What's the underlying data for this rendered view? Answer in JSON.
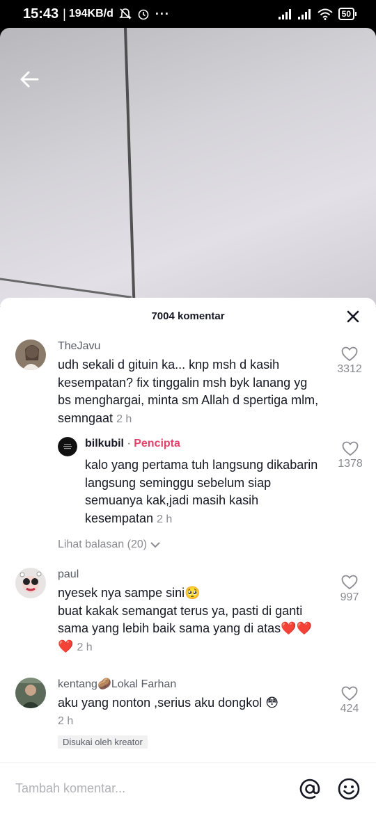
{
  "status_bar": {
    "time": "15:43",
    "separator": "|",
    "speed": "194KB/d",
    "more": "···",
    "battery": "50"
  },
  "sheet": {
    "title": "7004 komentar",
    "input_placeholder": "Tambah komentar..."
  },
  "comments": [
    {
      "user": "TheJavu",
      "text": "udh sekali d gituin ka... knp msh d kasih kesempatan? fix tinggalin msh byk lanang yg bs menghargai, minta sm Allah d spertiga mlm, semngaat",
      "time": "2 h",
      "likes": "3312",
      "reply": {
        "user": "bilkubil",
        "dot": " · ",
        "badge": "Pencipta",
        "text": "kalo yang pertama tuh langsung dikabarin langsung seminggu sebelum siap semuanya kak,jadi masih kasih kesempatan",
        "time": "2 h",
        "likes": "1378"
      },
      "view_replies": "Lihat balasan (20)"
    },
    {
      "user": "paul",
      "text_line1": "nyesek nya sampe sini🥺",
      "text_line2": "buat kakak semangat terus ya, pasti di ganti sama yang lebih baik sama yang di atas❤️❤️❤️",
      "time": "2 h",
      "likes": "997"
    },
    {
      "user": "kentang🥔Lokal Farhan",
      "text": "aku yang nonton ,serius aku dongkol 😳",
      "time": "2 h",
      "likes": "424",
      "liked_by_creator": "Disukai oleh kreator"
    }
  ],
  "colors": {
    "accent_creator": "#e2426a",
    "text_primary": "#161823",
    "text_secondary": "#8a8b91"
  },
  "icons": [
    "back-arrow-icon",
    "close-icon",
    "heart-icon",
    "at-icon",
    "emoji-icon",
    "chevron-down-icon"
  ]
}
